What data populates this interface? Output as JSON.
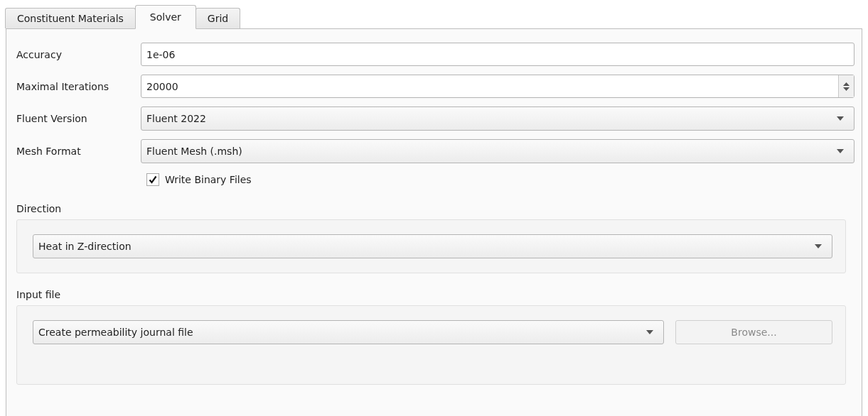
{
  "tabs": [
    {
      "label": "Constituent Materials",
      "selected": false
    },
    {
      "label": "Solver",
      "selected": true
    },
    {
      "label": "Grid",
      "selected": false
    }
  ],
  "form": [
    {
      "kind": "text",
      "label": "Accuracy",
      "value": "1e-06"
    },
    {
      "kind": "spin",
      "label": "Maximal Iterations",
      "value": "20000"
    },
    {
      "kind": "combo",
      "label": "Fluent Version",
      "value": "Fluent 2022"
    },
    {
      "kind": "combo",
      "label": "Mesh Format",
      "value": "Fluent Mesh (.msh)"
    }
  ],
  "write_binary": {
    "label": "Write Binary Files",
    "checked": true
  },
  "direction": {
    "title": "Direction",
    "value": "Heat in Z-direction"
  },
  "input_file": {
    "title": "Input file",
    "value": "Create permeability journal file",
    "browse": {
      "label": "Browse...",
      "disabled": true
    }
  }
}
